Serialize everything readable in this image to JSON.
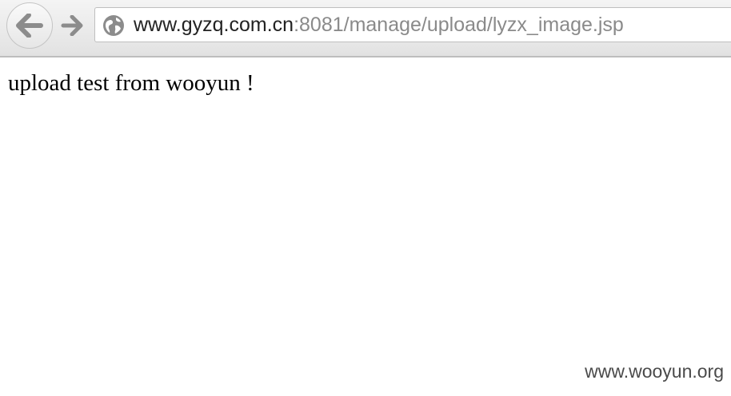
{
  "browser": {
    "back_icon": "arrow-left-icon",
    "forward_icon": "arrow-right-icon",
    "site_icon": "globe-icon",
    "address": {
      "host": "www.gyzq.com.cn",
      "rest": ":8081/manage/upload/lyzx_image.jsp"
    }
  },
  "page": {
    "body_text": "upload test from wooyun !"
  },
  "watermark": {
    "text": "www.wooyun.org"
  },
  "colors": {
    "host_text": "#222222",
    "path_text": "#8a8a8a",
    "icon_gray": "#8c8c8c"
  }
}
